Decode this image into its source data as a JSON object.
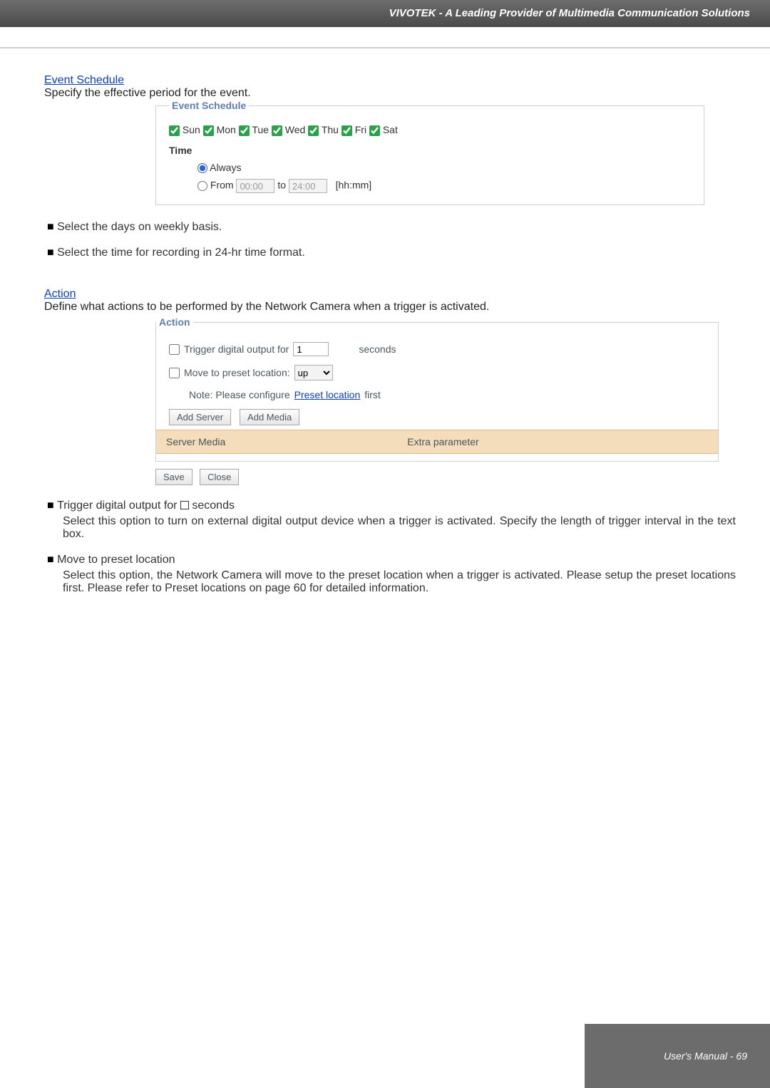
{
  "header": {
    "title": "VIVOTEK - A Leading Provider of Multimedia Communication Solutions"
  },
  "eventSchedule": {
    "heading": "Event Schedule",
    "intro": "Specify the effective period for the event.",
    "legend": "Event Schedule",
    "days": [
      {
        "label": "Sun",
        "checked": true
      },
      {
        "label": "Mon",
        "checked": true
      },
      {
        "label": "Tue",
        "checked": true
      },
      {
        "label": "Wed",
        "checked": true
      },
      {
        "label": "Thu",
        "checked": true
      },
      {
        "label": "Fri",
        "checked": true
      },
      {
        "label": "Sat",
        "checked": true
      }
    ],
    "time_label": "Time",
    "always_label": "Always",
    "from_label": "From",
    "from_val": "00:00",
    "to_label": "to",
    "to_val": "24:00",
    "hhmm": "[hh:mm]"
  },
  "schedBullets": {
    "a": "Select the days on weekly basis.",
    "b": "Select the time for recording in 24-hr time format."
  },
  "actionSection": {
    "heading": "Action",
    "intro": "Define what actions to be performed by the Network Camera when a trigger is activated.",
    "legend": "Action",
    "trigger_label_pre": "Trigger digital output for",
    "trigger_value": "1",
    "trigger_label_post": "seconds",
    "move_label": "Move to preset location:",
    "move_value": "up",
    "note_pre": "Note: Please configure ",
    "note_link": "Preset location",
    "note_post": " first",
    "add_server": "Add Server",
    "add_media": "Add Media",
    "server_col": "Server",
    "media_col": "Media",
    "extra_col": "Extra parameter",
    "save": "Save",
    "close": "Close"
  },
  "actionBullets": {
    "a": "Trigger digital output for ",
    "a2": " seconds",
    "a_exp": "Select this option to turn on external digital output device when a trigger is activated. Specify the length of trigger interval in the text box.",
    "b": "Move to preset location",
    "b_exp": "Select this option, the Network Camera will move to the preset location when a trigger is activated. Please setup the preset locations first. Please refer to Preset locations on page 60 for detailed information."
  },
  "footer": {
    "text": "User's Manual - 69"
  }
}
